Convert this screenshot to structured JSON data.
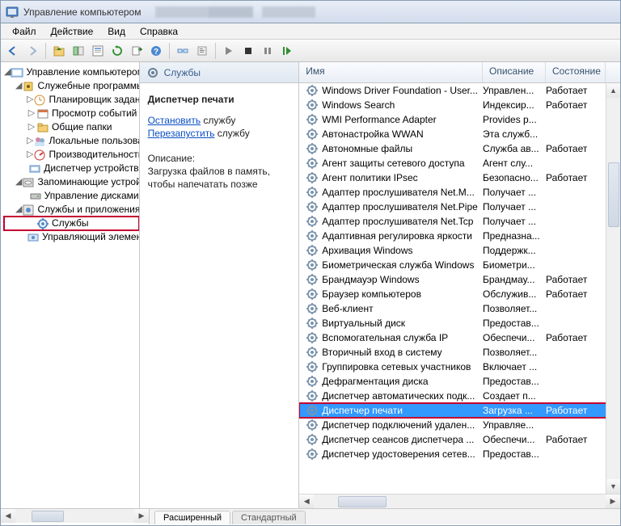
{
  "window": {
    "title": "Управление компьютером"
  },
  "menu": {
    "file": "Файл",
    "action": "Действие",
    "view": "Вид",
    "help": "Справка"
  },
  "tree": {
    "root": "Управление компьютером (л",
    "sys": "Служебные программы",
    "sched": "Планировщик заданий",
    "event": "Просмотр событий",
    "shared": "Общие папки",
    "users": "Локальные пользоват",
    "perf": "Производительность",
    "devmgr": "Диспетчер устройств",
    "storage": "Запоминающие устройс",
    "diskmgr": "Управление дисками",
    "apps": "Службы и приложения",
    "services": "Службы",
    "wmi": "Управляющий элемен"
  },
  "middle": {
    "header": "Службы",
    "title": "Диспетчер печати",
    "stop_link": "Остановить",
    "stop_tail": " службу",
    "restart_link": "Перезапустить",
    "restart_tail": " службу",
    "desc_label": "Описание:",
    "desc_text": "Загрузка файлов в память, чтобы напечатать позже"
  },
  "columns": {
    "name": "Имя",
    "desc": "Описание",
    "state": "Состояние"
  },
  "tabs": {
    "extended": "Расширенный",
    "standard": "Стандартный"
  },
  "services": [
    {
      "name": "Windows Driver Foundation - User...",
      "desc": "Управлен...",
      "state": "Работает"
    },
    {
      "name": "Windows Search",
      "desc": "Индексир...",
      "state": "Работает"
    },
    {
      "name": "WMI Performance Adapter",
      "desc": "Provides p...",
      "state": ""
    },
    {
      "name": "Автонастройка WWAN",
      "desc": "Эта служб...",
      "state": ""
    },
    {
      "name": "Автономные файлы",
      "desc": "Служба ав...",
      "state": "Работает"
    },
    {
      "name": "Агент защиты сетевого доступа",
      "desc": "Агент слу...",
      "state": ""
    },
    {
      "name": "Агент политики IPsec",
      "desc": "Безопасно...",
      "state": "Работает"
    },
    {
      "name": "Адаптер прослушивателя Net.M...",
      "desc": "Получает ...",
      "state": ""
    },
    {
      "name": "Адаптер прослушивателя Net.Pipe",
      "desc": "Получает ...",
      "state": ""
    },
    {
      "name": "Адаптер прослушивателя Net.Tcp",
      "desc": "Получает ...",
      "state": ""
    },
    {
      "name": "Адаптивная регулировка яркости",
      "desc": "Предназна...",
      "state": ""
    },
    {
      "name": "Архивация Windows",
      "desc": "Поддержк...",
      "state": ""
    },
    {
      "name": "Биометрическая служба Windows",
      "desc": "Биометри...",
      "state": ""
    },
    {
      "name": "Брандмауэр Windows",
      "desc": "Брандмау...",
      "state": "Работает"
    },
    {
      "name": "Браузер компьютеров",
      "desc": "Обслужив...",
      "state": "Работает"
    },
    {
      "name": "Веб-клиент",
      "desc": "Позволяет...",
      "state": ""
    },
    {
      "name": "Виртуальный диск",
      "desc": "Предостав...",
      "state": ""
    },
    {
      "name": "Вспомогательная служба IP",
      "desc": "Обеспечи...",
      "state": "Работает"
    },
    {
      "name": "Вторичный вход в систему",
      "desc": "Позволяет...",
      "state": ""
    },
    {
      "name": "Группировка сетевых участников",
      "desc": "Включает ...",
      "state": ""
    },
    {
      "name": "Дефрагментация диска",
      "desc": "Предостав...",
      "state": ""
    },
    {
      "name": "Диспетчер автоматических подк...",
      "desc": "Создает п...",
      "state": ""
    },
    {
      "name": "Диспетчер печати",
      "desc": "Загрузка ...",
      "state": "Работает",
      "selected": true,
      "highlight": true
    },
    {
      "name": "Диспетчер подключений удален...",
      "desc": "Управляе...",
      "state": ""
    },
    {
      "name": "Диспетчер сеансов диспетчера ...",
      "desc": "Обеспечи...",
      "state": "Работает"
    },
    {
      "name": "Диспетчер удостоверения сетев...",
      "desc": "Предостав...",
      "state": ""
    }
  ]
}
